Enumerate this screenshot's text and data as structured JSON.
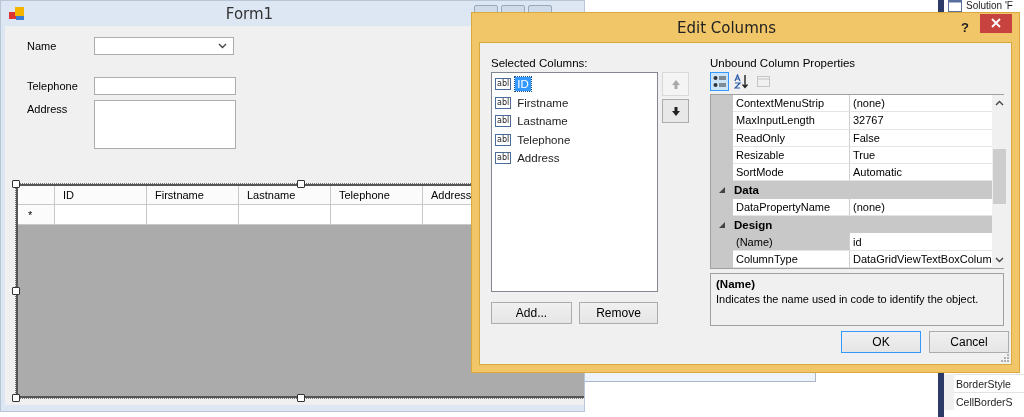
{
  "form_window": {
    "title": "Form1",
    "fields": [
      {
        "kind": "combo",
        "label": "Name"
      },
      {
        "kind": "text",
        "label": "Telephone"
      },
      {
        "kind": "multiline",
        "label": "Address"
      }
    ],
    "grid": {
      "columns": [
        "ID",
        "Firstname",
        "Lastname",
        "Telephone",
        "Address"
      ],
      "new_row_marker": "*"
    }
  },
  "dialog": {
    "title": "Edit Columns",
    "help": "?",
    "selected_columns": {
      "label": "Selected Columns:",
      "items": [
        {
          "glyph": "abl",
          "name": "ID",
          "selected": true
        },
        {
          "glyph": "abl",
          "name": "Firstname",
          "selected": false
        },
        {
          "glyph": "abl",
          "name": "Lastname",
          "selected": false
        },
        {
          "glyph": "abl",
          "name": "Telephone",
          "selected": false
        },
        {
          "glyph": "abl",
          "name": "Address",
          "selected": false
        }
      ]
    },
    "move_buttons": [
      {
        "kind": "up",
        "disabled": true
      },
      {
        "kind": "down",
        "disabled": false
      }
    ],
    "list_buttons": [
      "Add...",
      "Remove"
    ],
    "properties": {
      "label": "Unbound Column Properties",
      "toolbar": [
        {
          "kind": "categorized",
          "selected": true,
          "disabled": false
        },
        {
          "kind": "alphabetical",
          "selected": false,
          "disabled": false
        },
        {
          "kind": "property_pages",
          "selected": false,
          "disabled": true
        }
      ],
      "rows": [
        {
          "kind": "property",
          "name": "ContextMenuStrip",
          "value": "(none)",
          "selected": false
        },
        {
          "kind": "property",
          "name": "MaxInputLength",
          "value": "32767",
          "selected": false
        },
        {
          "kind": "property",
          "name": "ReadOnly",
          "value": "False",
          "selected": false
        },
        {
          "kind": "property",
          "name": "Resizable",
          "value": "True",
          "selected": false
        },
        {
          "kind": "property",
          "name": "SortMode",
          "value": "Automatic",
          "selected": false
        },
        {
          "kind": "category",
          "name": "Data",
          "expanded": true
        },
        {
          "kind": "property",
          "name": "DataPropertyName",
          "value": "(none)",
          "selected": false
        },
        {
          "kind": "category",
          "name": "Design",
          "expanded": true
        },
        {
          "kind": "property",
          "name": "(Name)",
          "value": "id",
          "selected": true
        },
        {
          "kind": "property",
          "name": "ColumnType",
          "value": "DataGridViewTextBoxColum",
          "selected": false
        }
      ],
      "description": {
        "title": "(Name)",
        "text": "Indicates the name used in code to identify the object."
      }
    },
    "buttons": [
      {
        "label": "OK",
        "default": true
      },
      {
        "label": "Cancel",
        "default": false
      }
    ]
  },
  "background": {
    "solution_explorer_title": "Solution 'F",
    "property_items": [
      "BorderStyle",
      "CellBorderS"
    ]
  }
}
